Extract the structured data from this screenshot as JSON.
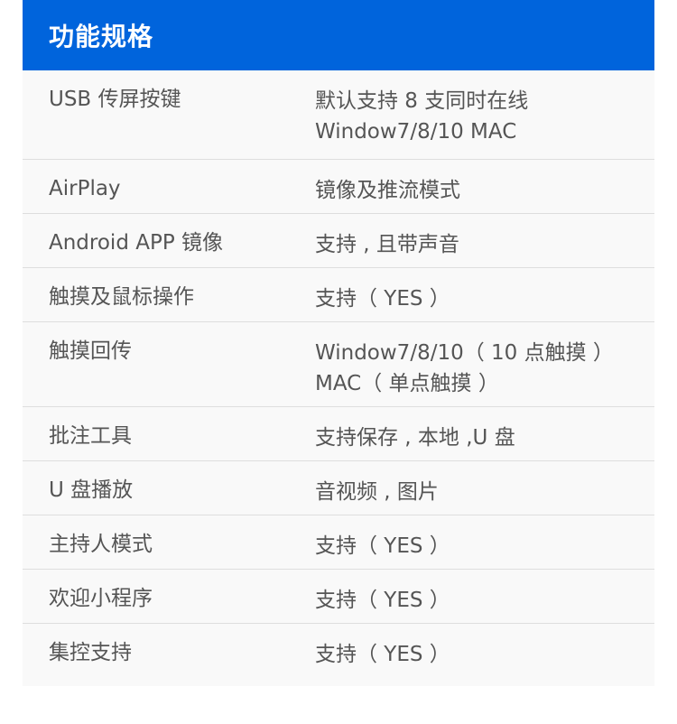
{
  "header": {
    "title": "功能规格"
  },
  "colors": {
    "header_bg": "#0064dc",
    "row_bg": "#f9f9f9",
    "divider": "#dedede",
    "text": "#555555"
  },
  "specs": [
    {
      "label": "USB 传屏按键",
      "value": "默认支持 8 支同时在线\nWindow7/8/10 MAC"
    },
    {
      "label": "AirPlay",
      "value": "镜像及推流模式"
    },
    {
      "label": "Android APP 镜像",
      "value": "支持 , 且带声音"
    },
    {
      "label": "触摸及鼠标操作",
      "value": "支持（ YES ）"
    },
    {
      "label": "触摸回传",
      "value": "Window7/8/10（ 10 点触摸 ）\n MAC（ 单点触摸 ）"
    },
    {
      "label": "批注工具",
      "value": "支持保存 , 本地 ,U 盘"
    },
    {
      "label": "U 盘播放",
      "value": "音视频 , 图片"
    },
    {
      "label": "主持人模式",
      "value": "支持（ YES ）"
    },
    {
      "label": "欢迎小程序",
      "value": "支持（ YES ）"
    },
    {
      "label": "集控支持",
      "value": "支持（ YES ）"
    }
  ]
}
